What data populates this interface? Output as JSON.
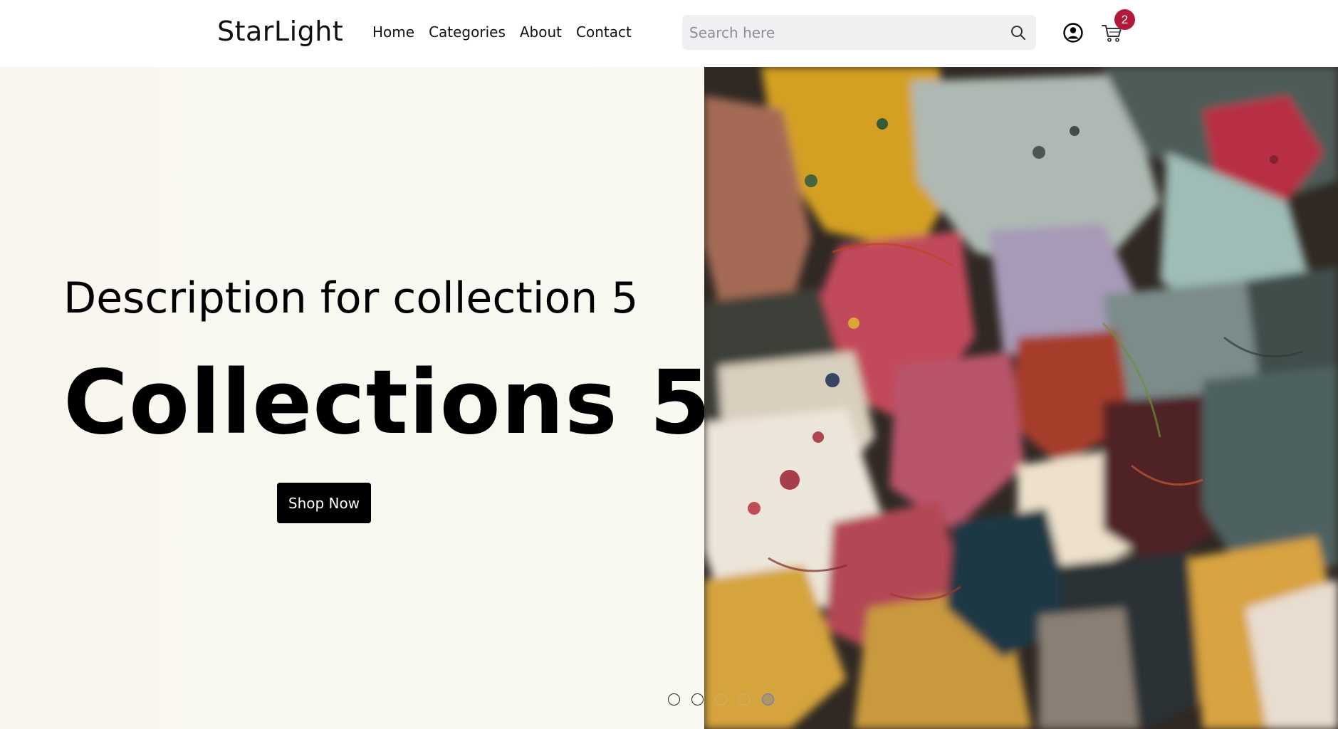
{
  "header": {
    "logo": "StarLight",
    "nav": [
      "Home",
      "Categories",
      "About",
      "Contact"
    ],
    "search_placeholder": "Search here",
    "cart_count": "2"
  },
  "hero": {
    "description": "Description for collection 5",
    "title": "Collections 5",
    "cta_label": "Shop Now",
    "slide_count": 5,
    "active_slide": 5
  },
  "colors": {
    "badge": "#b3173a",
    "cta_bg": "#000000",
    "hero_bg": "#f9f8f1",
    "search_bg": "#eff0f2"
  },
  "icons": {
    "search": "search-icon",
    "user": "user-circle-icon",
    "cart": "shopping-cart-icon"
  }
}
